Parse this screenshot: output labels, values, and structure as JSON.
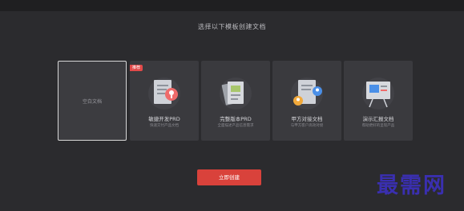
{
  "title": "选择以下模板创建文档",
  "blank": {
    "label": "空白文档"
  },
  "templates": [
    {
      "name": "敏捷开发PRD",
      "desc": "快速交付产品文档",
      "tag": "推荐",
      "icon": "agile-prd-icon"
    },
    {
      "name": "完整版本PRD",
      "desc": "全面描述产品信息需求",
      "icon": "full-prd-icon"
    },
    {
      "name": "甲方对接文档",
      "desc": "与甲方客户高效对接",
      "icon": "client-doc-icon"
    },
    {
      "name": "演示汇报文档",
      "desc": "帮助更好的呈现产品",
      "icon": "presentation-icon"
    }
  ],
  "create_button": "立即创建",
  "watermark": "最需网",
  "colors": {
    "accent": "#d9423b",
    "tag": "#e24a4a",
    "background": "#2b2b2e",
    "card": "#3a3a3e"
  }
}
